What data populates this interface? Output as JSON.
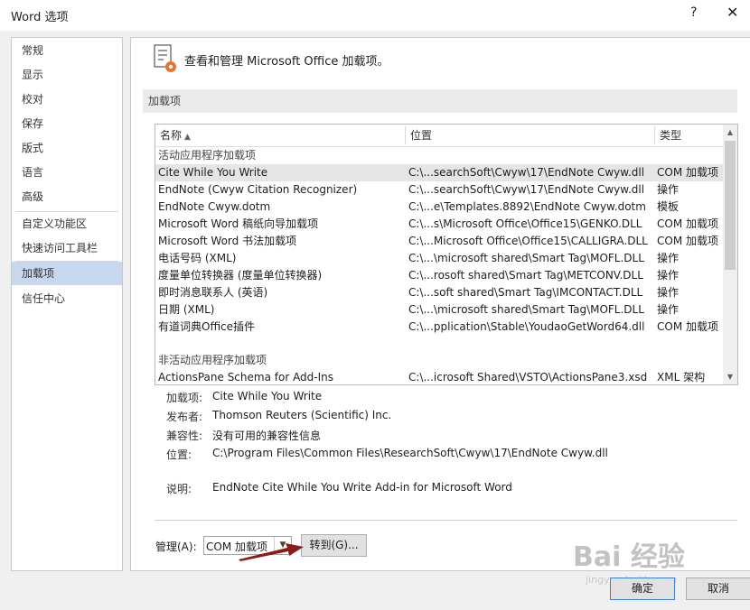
{
  "window": {
    "title": "Word 选项",
    "help": "?",
    "close": "✕"
  },
  "sidebar": {
    "items": [
      {
        "label": "常规"
      },
      {
        "label": "显示"
      },
      {
        "label": "校对"
      },
      {
        "label": "保存"
      },
      {
        "label": "版式"
      },
      {
        "label": "语言"
      },
      {
        "label": "高级"
      },
      {
        "label": "自定义功能区"
      },
      {
        "label": "快速访问工具栏"
      },
      {
        "label": "加载项"
      },
      {
        "label": "信任中心"
      }
    ],
    "selected": "加载项"
  },
  "header": {
    "text": "查看和管理 Microsoft Office 加载项。"
  },
  "section": {
    "title": "加载项"
  },
  "list": {
    "columns": {
      "name": "名称",
      "location": "位置",
      "type": "类型"
    },
    "groups": [
      {
        "title": "活动应用程序加载项",
        "rows": [
          {
            "name": "Cite While You Write",
            "location": "C:\\...searchSoft\\Cwyw\\17\\EndNote Cwyw.dll",
            "type": "COM 加载项"
          },
          {
            "name": "EndNote (Cwyw Citation Recognizer)",
            "location": "C:\\...searchSoft\\Cwyw\\17\\EndNote Cwyw.dll",
            "type": "操作"
          },
          {
            "name": "EndNote Cwyw.dotm",
            "location": "C:\\...e\\Templates.8892\\EndNote Cwyw.dotm",
            "type": "模板"
          },
          {
            "name": "Microsoft Word 稿纸向导加载项",
            "location": "C:\\...s\\Microsoft Office\\Office15\\GENKO.DLL",
            "type": "COM 加载项"
          },
          {
            "name": "Microsoft Word 书法加载项",
            "location": "C:\\...Microsoft Office\\Office15\\CALLIGRA.DLL",
            "type": "COM 加载项"
          },
          {
            "name": "电话号码 (XML)",
            "location": "C:\\...\\microsoft shared\\Smart Tag\\MOFL.DLL",
            "type": "操作"
          },
          {
            "name": "度量单位转换器 (度量单位转换器)",
            "location": "C:\\...rosoft shared\\Smart Tag\\METCONV.DLL",
            "type": "操作"
          },
          {
            "name": "即时消息联系人 (英语)",
            "location": "C:\\...soft shared\\Smart Tag\\IMCONTACT.DLL",
            "type": "操作"
          },
          {
            "name": "日期 (XML)",
            "location": "C:\\...\\microsoft shared\\Smart Tag\\MOFL.DLL",
            "type": "操作"
          },
          {
            "name": "有道词典Office插件",
            "location": "C:\\...pplication\\Stable\\YoudaoGetWord64.dll",
            "type": "COM 加载项"
          }
        ]
      },
      {
        "title": "非活动应用程序加载项",
        "rows": [
          {
            "name": "ActionsPane Schema for Add-Ins",
            "location": "C:\\...icrosoft Shared\\VSTO\\ActionsPane3.xsd",
            "type": "XML 架构"
          }
        ]
      }
    ]
  },
  "details": {
    "addin_label": "加载项:",
    "addin_value": "Cite While You Write",
    "publisher_label": "发布者:",
    "publisher_value": "Thomson Reuters (Scientific) Inc.",
    "compat_label": "兼容性:",
    "compat_value": "没有可用的兼容性信息",
    "location_label": "位置:",
    "location_value": "C:\\Program Files\\Common Files\\ResearchSoft\\Cwyw\\17\\EndNote Cwyw.dll",
    "desc_label": "说明:",
    "desc_value": "EndNote Cite While You Write Add-in for Microsoft Word"
  },
  "manage": {
    "label": "管理(A):",
    "selected": "COM 加载项",
    "go_button": "转到(G)..."
  },
  "footer": {
    "ok": "确定",
    "cancel": "取消"
  },
  "watermark": {
    "text": "Bai 经验",
    "sub": "jingyan.baidu.com"
  },
  "colors": {
    "selected_nav": "#c7d8ee",
    "selected_row": "#e5e5e5",
    "arrow": "#8b1a1a",
    "ok_border": "#3c7fd8"
  }
}
